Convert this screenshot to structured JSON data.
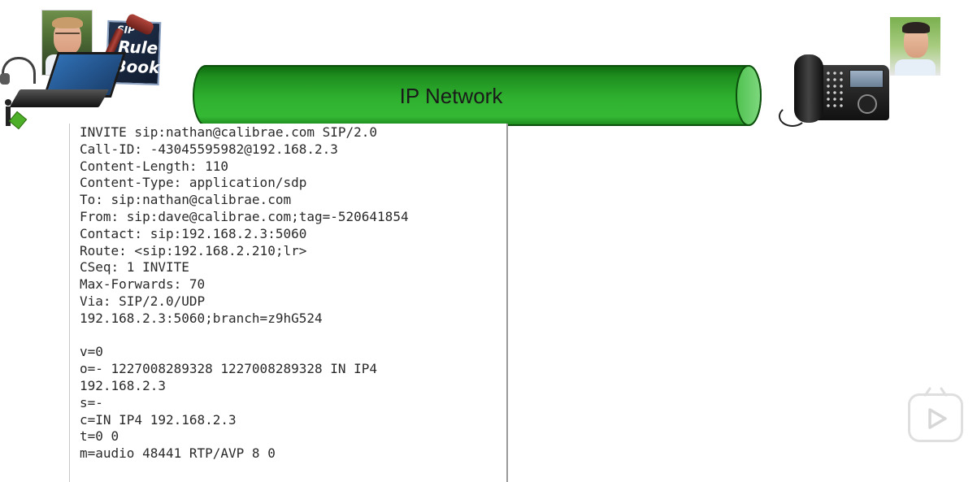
{
  "network": {
    "label": "IP Network",
    "color": "#22a022"
  },
  "left_endpoint": {
    "rulebook_line1": "SIP",
    "rulebook_line2": "Rule",
    "rulebook_line3": "Book"
  },
  "sip_message": {
    "lines": [
      "INVITE sip:nathan@calibrae.com SIP/2.0",
      "Call-ID: -43045595982@192.168.2.3",
      "Content-Length: 110",
      "Content-Type: application/sdp",
      "To: sip:nathan@calibrae.com",
      "From: sip:dave@calibrae.com;tag=-520641854",
      "Contact: sip:192.168.2.3:5060",
      "Route: <sip:192.168.2.210;lr>",
      "CSeq: 1 INVITE",
      "Max-Forwards: 70",
      "Via: SIP/2.0/UDP",
      "192.168.2.3:5060;branch=z9hG524",
      "",
      "v=0",
      "o=- 1227008289328 1227008289328 IN IP4",
      "192.168.2.3",
      "s=-",
      "c=IN IP4 192.168.2.3",
      "t=0 0",
      "m=audio 48441 RTP/AVP 8 0"
    ]
  },
  "icons": {
    "play": "play-icon",
    "phone": "desk-phone-icon",
    "laptop": "laptop-icon",
    "headset": "headset-icon",
    "gavel": "gavel-icon"
  }
}
